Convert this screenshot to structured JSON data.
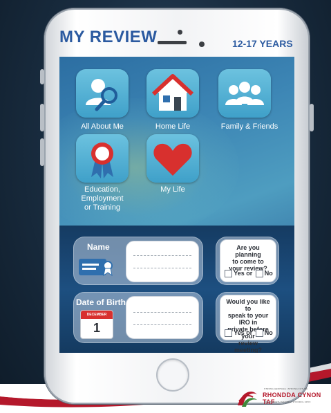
{
  "header": {
    "title": "MY REVIEW",
    "age_range": "12-17 YEARS"
  },
  "tiles": [
    {
      "label": "All About Me",
      "icon": "person-magnifier-icon"
    },
    {
      "label": "Home Life",
      "icon": "house-icon"
    },
    {
      "label": "Family & Friends",
      "icon": "people-group-icon"
    },
    {
      "label_lines": [
        "Education,",
        "Employment",
        "or Training"
      ],
      "icon": "rosette-award-icon"
    },
    {
      "label": "My Life",
      "icon": "heart-icon"
    }
  ],
  "form": {
    "name_label": "Name",
    "dob_label": "Date of Birth",
    "calendar_month": "DECEMBER",
    "calendar_day": "1",
    "question1": [
      "Are you planning",
      "to come to",
      "your review?"
    ],
    "question2": [
      "Would you like to",
      "speak to your IRO in",
      "private before your",
      "review meeting?"
    ],
    "yes_label": "Yes or",
    "no_label": "No"
  },
  "branding": {
    "tagline_left": "STRONG HERITAGE | STRONG FUTURE",
    "organisation": "RHONDDA CYNON TAF",
    "tagline_right": "TREFTADAETH GADARN | DYFODOL CRYF"
  },
  "colors": {
    "title_blue": "#2b5aa0",
    "tile_blue": "#4fb0d6",
    "brand_red": "#b4182b",
    "brand_green": "#3f8a3a"
  }
}
